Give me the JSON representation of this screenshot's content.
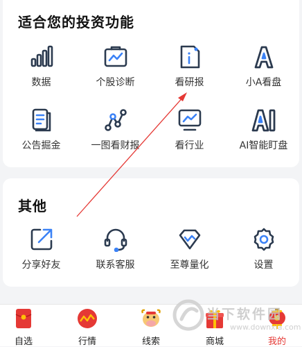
{
  "features": {
    "title": "适合您的投资功能",
    "items": [
      {
        "label": "数据",
        "icon": "bar-chart-icon"
      },
      {
        "label": "个股诊断",
        "icon": "stock-diagnosis-icon"
      },
      {
        "label": "看研报",
        "icon": "research-report-icon"
      },
      {
        "label": "小A看盘",
        "icon": "letter-a-icon"
      },
      {
        "label": "公告掘金",
        "icon": "announcement-icon"
      },
      {
        "label": "一图看财报",
        "icon": "node-graph-icon"
      },
      {
        "label": "看行业",
        "icon": "industry-monitor-icon"
      },
      {
        "label": "AI智能盯盘",
        "icon": "ai-icon"
      }
    ]
  },
  "others": {
    "title": "其他",
    "items": [
      {
        "label": "分享好友",
        "icon": "share-icon"
      },
      {
        "label": "联系客服",
        "icon": "headset-icon"
      },
      {
        "label": "至尊量化",
        "icon": "diamond-icon"
      },
      {
        "label": "设置",
        "icon": "gear-icon"
      }
    ]
  },
  "bottom_nav": {
    "items": [
      {
        "label": "自选",
        "icon": "red-envelope-icon"
      },
      {
        "label": "行情",
        "icon": "market-icon"
      },
      {
        "label": "线索",
        "icon": "ox-mascot-icon"
      },
      {
        "label": "商城",
        "icon": "gift-box-icon"
      },
      {
        "label": "我的",
        "icon": "lantern-icon",
        "active": true
      }
    ]
  },
  "watermark": {
    "text": "当下软件园",
    "url": "www.downxia.com"
  },
  "colors": {
    "icon": "#2b3a4f",
    "accent": "#3b82f6",
    "active_nav": "#e53935",
    "annotation_arrow": "#e53935"
  }
}
